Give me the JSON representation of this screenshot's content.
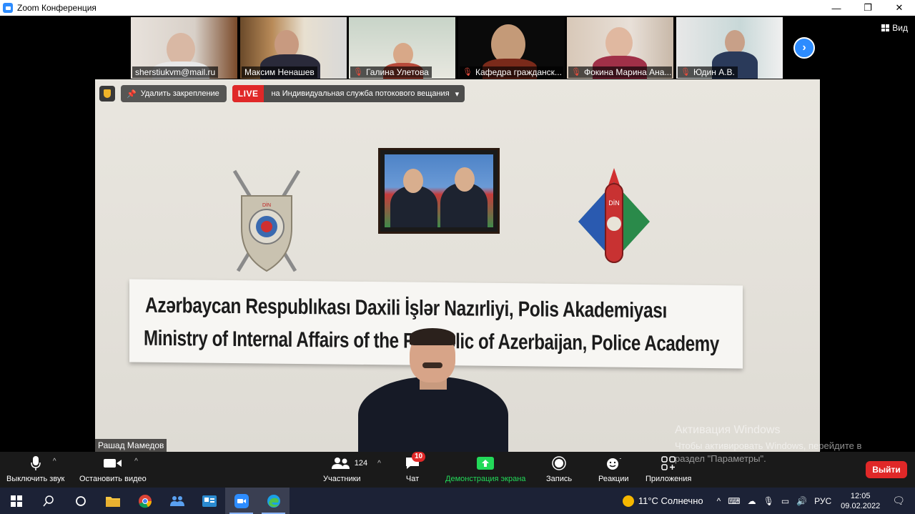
{
  "window": {
    "title": "Zoom Конференция",
    "minimize": "—",
    "maximize": "❐",
    "close": "✕"
  },
  "view_button": "Вид",
  "thumbnails": [
    {
      "name": "sherstiukvm@mail.ru",
      "muted": false
    },
    {
      "name": "Максим Ненашев",
      "muted": false
    },
    {
      "name": "Галина Улетова",
      "muted": true
    },
    {
      "name": "Кафедра гражданск...",
      "muted": true
    },
    {
      "name": "Фокина Марина Ана...",
      "muted": true
    },
    {
      "name": "Юдин А.В.",
      "muted": true
    }
  ],
  "overlay": {
    "unpin": "Удалить закрепление",
    "live": "LIVE",
    "live_text": "на Индивидуальная служба потокового вещания"
  },
  "banner": {
    "line1": "Azərbaycan Respublıkası Daxili İşlər Nazırliyi, Polis Akademiyası",
    "line2": "Ministry of Internal Affairs of the Republic of Azerbaijan, Police Academy"
  },
  "emblem_text": "DİN",
  "speaker_name": "Рашад Мамедов",
  "activation": {
    "title": "Активация Windows",
    "text": "Чтобы активировать Windows, перейдите в раздел \"Параметры\"."
  },
  "toolbar": {
    "mute": "Выключить звук",
    "video": "Остановить видео",
    "participants": "Участники",
    "participants_count": "124",
    "chat": "Чат",
    "chat_badge": "10",
    "share": "Демонстрация экрана",
    "record": "Запись",
    "reactions": "Реакции",
    "apps": "Приложения",
    "leave": "Выйти"
  },
  "taskbar": {
    "weather": "11°C  Солнечно",
    "lang": "РУС",
    "time": "12:05",
    "date": "09.02.2022"
  },
  "colors": {
    "accent": "#2D8CFF",
    "leave": "#E02828",
    "share_green": "#23D959"
  }
}
